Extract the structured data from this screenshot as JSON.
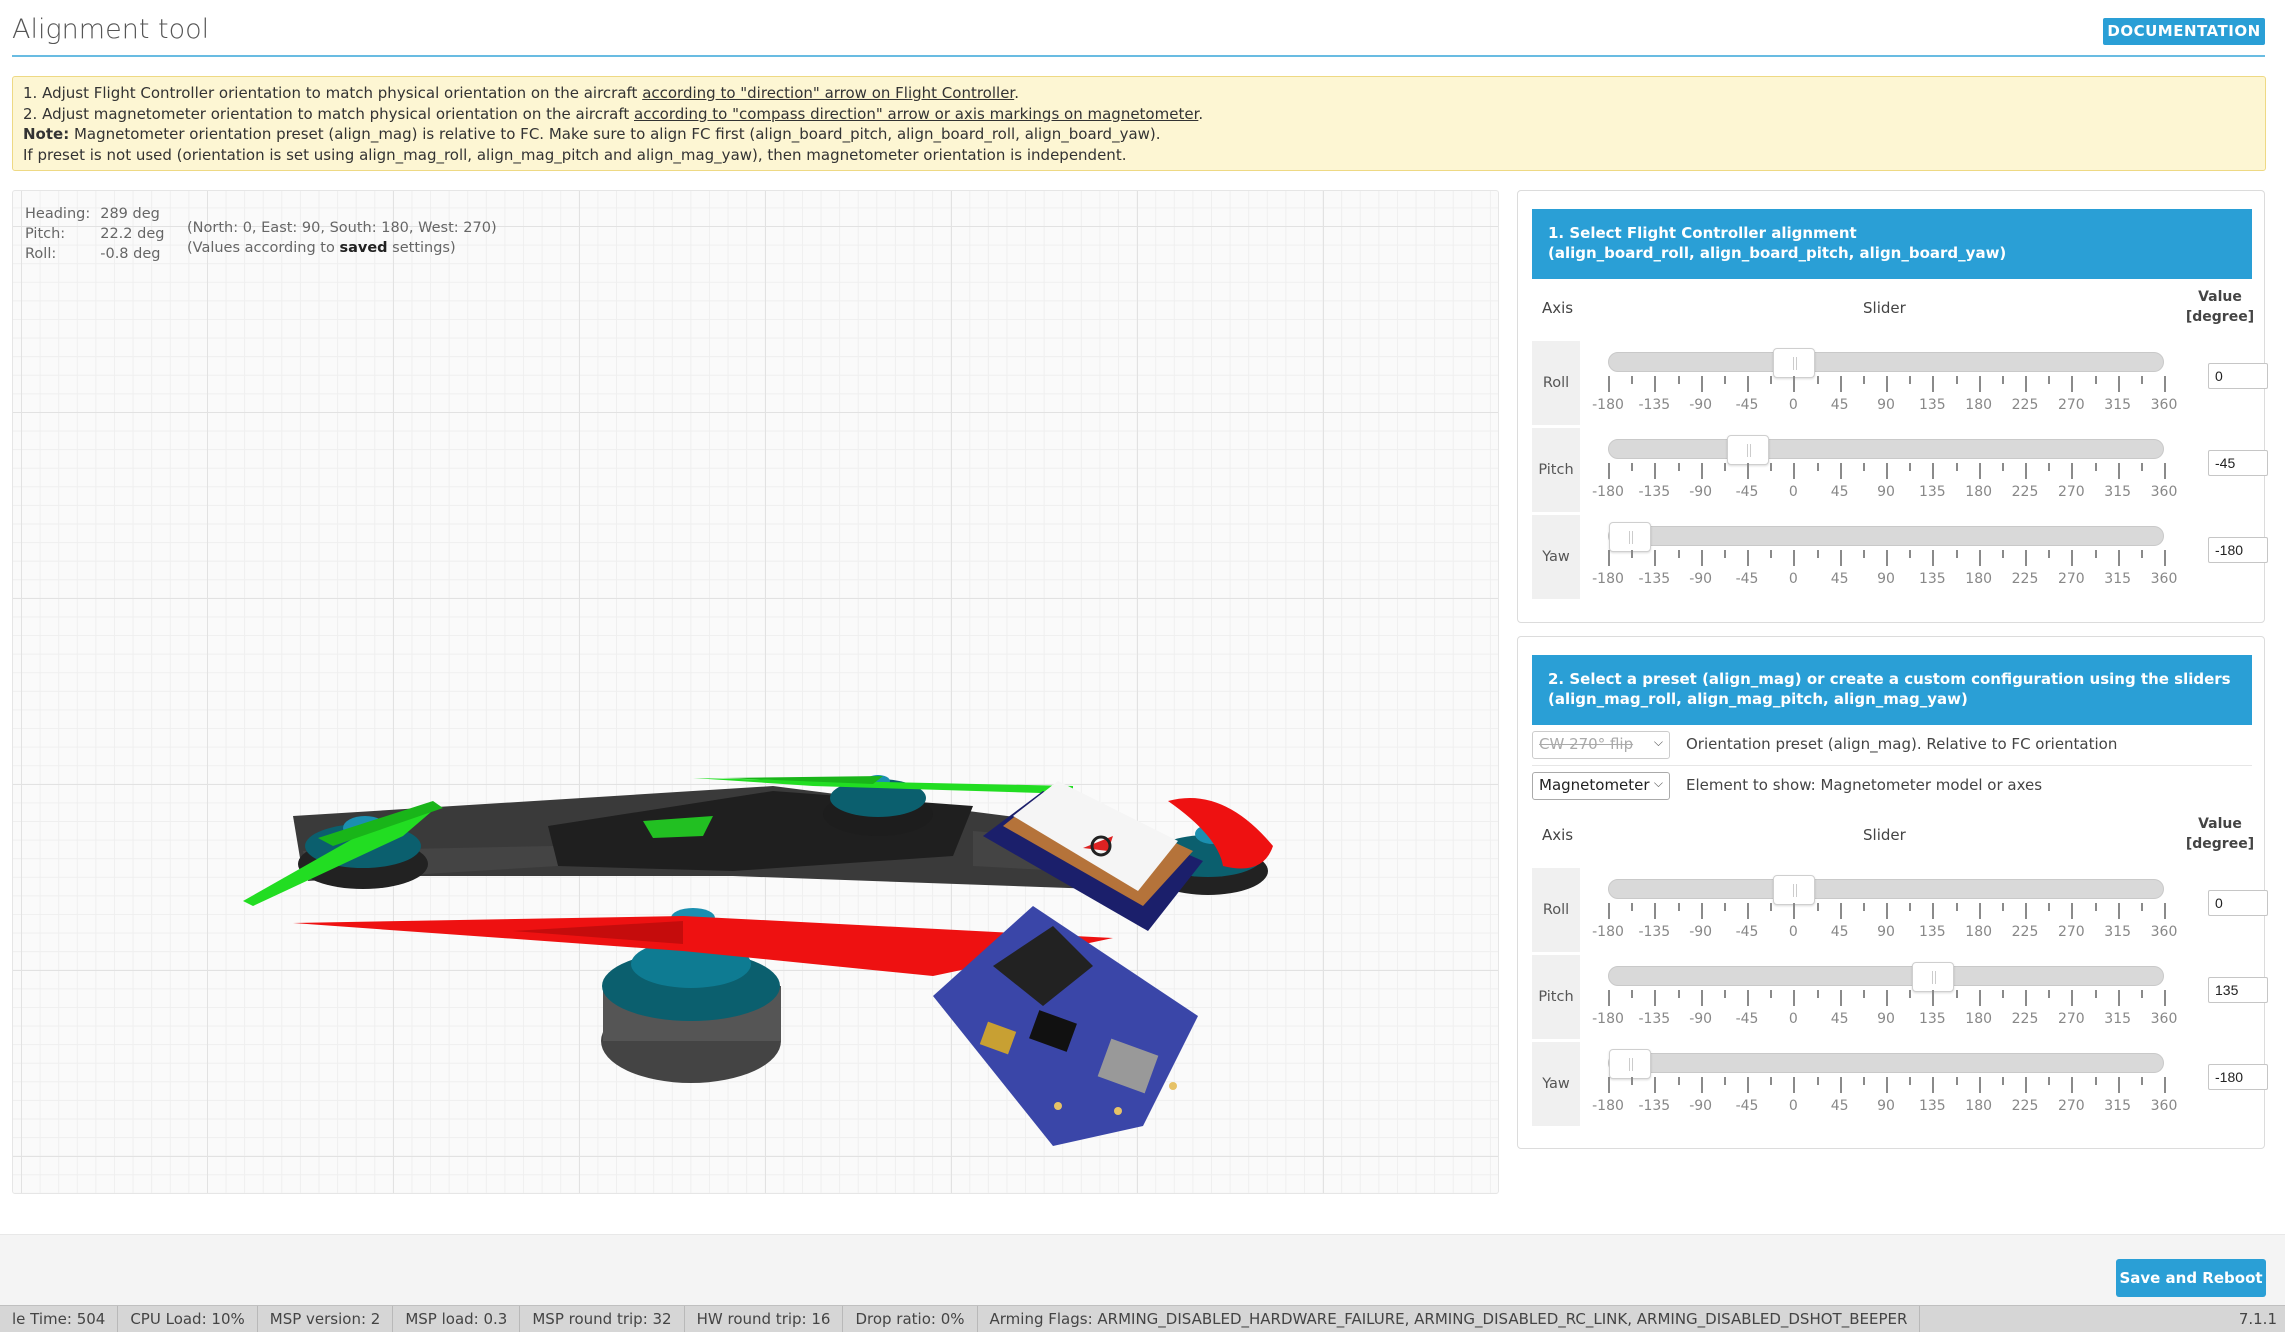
{
  "header": {
    "title": "Alignment tool",
    "doc_button": "DOCUMENTATION"
  },
  "note": {
    "line1_pre": "1. Adjust Flight Controller orientation to match physical orientation on the aircraft ",
    "line1_link": "according to \"direction\" arrow on Flight Controller",
    "line1_post": ".",
    "line2_pre": "2. Adjust magnetometer orientation to match physical orientation on the aircraft ",
    "line2_link": "according to \"compass direction\" arrow or axis markings on magnetometer",
    "line2_post": ".",
    "line3_bold": "Note:",
    "line3_text": " Magnetometer orientation preset (align_mag) is relative to FC. Make sure to align FC first (align_board_pitch, align_board_roll, align_board_yaw).",
    "line4": "If preset is not used (orientation is set using align_mag_roll, align_mag_pitch and align_mag_yaw), then magnetometer orientation is independent."
  },
  "readout": {
    "heading_label": "Heading:",
    "heading_value": "289 deg",
    "pitch_label": "Pitch:",
    "pitch_value": "22.2 deg",
    "roll_label": "Roll:",
    "roll_value": "-0.8 deg",
    "hint1": "(North: 0, East: 90, South: 180, West: 270)",
    "hint2_pre": "(Values according to ",
    "hint2_bold": "saved",
    "hint2_post": " settings)"
  },
  "scale_labels": [
    "-180",
    "-135",
    "-90",
    "-45",
    "0",
    "45",
    "90",
    "135",
    "180",
    "225",
    "270",
    "315",
    "360"
  ],
  "panel1": {
    "heading_line1": "1. Select Flight Controller alignment",
    "heading_line2": "(align_board_roll, align_board_pitch, align_board_yaw)",
    "col_axis": "Axis",
    "col_slider": "Slider",
    "col_value_1": "Value",
    "col_value_2": "[degree]",
    "rows": [
      {
        "label": "Roll",
        "value": "0",
        "slider_value": 0
      },
      {
        "label": "Pitch",
        "value": "-45",
        "slider_value": -45
      },
      {
        "label": "Yaw",
        "value": "-180",
        "slider_value": -180
      }
    ]
  },
  "panel2": {
    "heading_line1": "2. Select a preset (align_mag) or create a custom configuration using the sliders",
    "heading_line2": "(align_mag_roll, align_mag_pitch, align_mag_yaw)",
    "preset_select": "CW 270° flip",
    "preset_desc": "Orientation preset (align_mag). Relative to FC orientation",
    "element_select": "Magnetometer",
    "element_desc": "Element to show: Magnetometer model or axes",
    "col_axis": "Axis",
    "col_slider": "Slider",
    "col_value_1": "Value",
    "col_value_2": "[degree]",
    "rows": [
      {
        "label": "Roll",
        "value": "0",
        "slider_value": 0
      },
      {
        "label": "Pitch",
        "value": "135",
        "slider_value": 135
      },
      {
        "label": "Yaw",
        "value": "-180",
        "slider_value": -180
      }
    ]
  },
  "save_button": "Save and Reboot",
  "status": {
    "items": [
      "le Time: 504",
      "CPU Load: 10%",
      "MSP version: 2",
      "MSP load: 0.3",
      "MSP round trip: 32",
      "HW round trip: 16",
      "Drop ratio: 0%",
      "Arming Flags: ARMING_DISABLED_HARDWARE_FAILURE, ARMING_DISABLED_RC_LINK, ARMING_DISABLED_DSHOT_BEEPER"
    ],
    "version": "7.1.1"
  },
  "colors": {
    "accent": "#2a9fd6",
    "note_bg": "#fdf6d3",
    "prop_green": "#22dd22",
    "prop_red": "#ee1111",
    "pcb_blue": "#3a46a8"
  }
}
